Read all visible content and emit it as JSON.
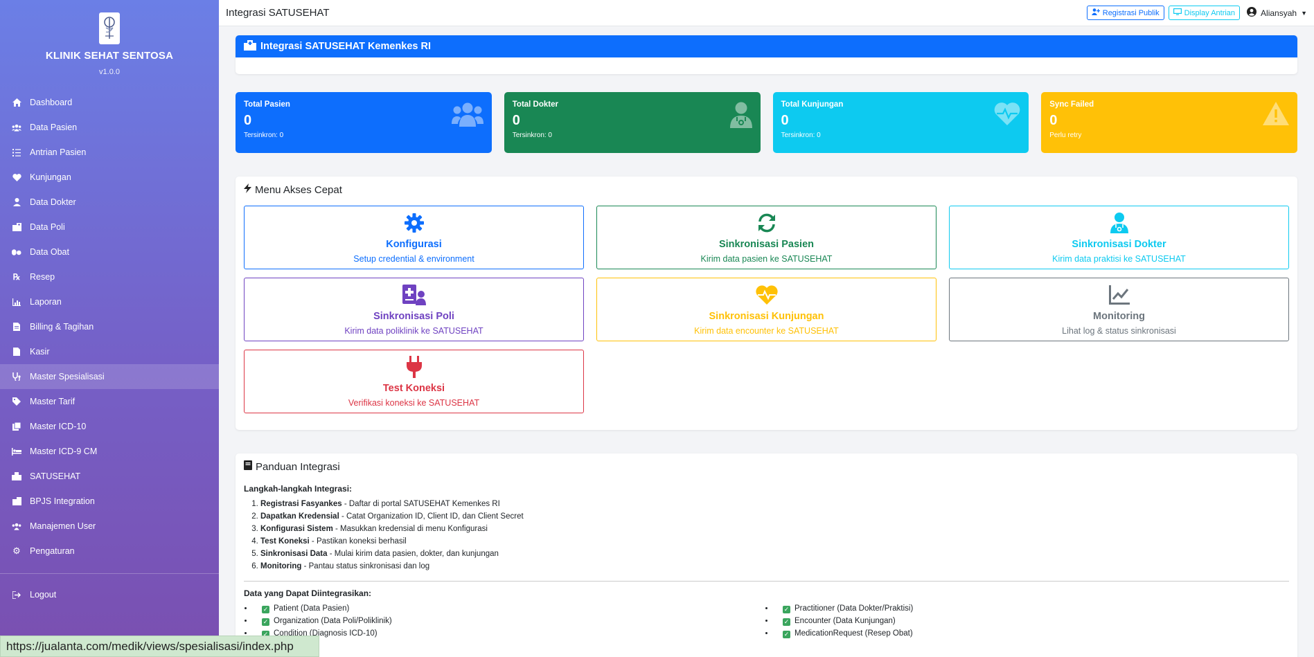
{
  "sidebar": {
    "brand_name": "KLINIK SEHAT SENTOSA",
    "version": "v1.0.0",
    "items": [
      {
        "label": "Dashboard",
        "icon": "home-icon"
      },
      {
        "label": "Data Pasien",
        "icon": "users-icon"
      },
      {
        "label": "Antrian Pasien",
        "icon": "list-ol-icon"
      },
      {
        "label": "Kunjungan",
        "icon": "heartbeat-icon"
      },
      {
        "label": "Data Dokter",
        "icon": "user-md-icon"
      },
      {
        "label": "Data Poli",
        "icon": "hospital-icon"
      },
      {
        "label": "Data Obat",
        "icon": "pills-icon"
      },
      {
        "label": "Resep",
        "icon": "prescription-icon"
      },
      {
        "label": "Laporan",
        "icon": "chart-line-icon"
      },
      {
        "label": "Billing & Tagihan",
        "icon": "invoice-icon"
      },
      {
        "label": "Kasir",
        "icon": "cash-register-icon"
      },
      {
        "label": "Master Spesialisasi",
        "icon": "stethoscope-icon"
      },
      {
        "label": "Master Tarif",
        "icon": "tags-icon"
      },
      {
        "label": "Master ICD-10",
        "icon": "book-medical-icon"
      },
      {
        "label": "Master ICD-9 CM",
        "icon": "procedures-icon"
      },
      {
        "label": "SATUSEHAT",
        "icon": "clinic-icon"
      },
      {
        "label": "BPJS Integration",
        "icon": "building-icon"
      },
      {
        "label": "Manajemen User",
        "icon": "users-cog-icon"
      },
      {
        "label": "Pengaturan",
        "icon": "cog-icon"
      }
    ],
    "logout": "Logout"
  },
  "topbar": {
    "title": "Integrasi SATUSEHAT",
    "btn_registrasi": "Registrasi Publik",
    "btn_display": "Display Antrian",
    "user": "Aliansyah"
  },
  "header": {
    "title": "Integrasi SATUSEHAT Kemenkes RI"
  },
  "stats": [
    {
      "label": "Total Pasien",
      "value": "0",
      "sub": "Tersinkron: 0",
      "color": "#0d6efd"
    },
    {
      "label": "Total Dokter",
      "value": "0",
      "sub": "Tersinkron: 0",
      "color": "#198754"
    },
    {
      "label": "Total Kunjungan",
      "value": "0",
      "sub": "Tersinkron: 0",
      "color": "#0dcaf0"
    },
    {
      "label": "Sync Failed",
      "value": "0",
      "sub": "Perlu retry",
      "color": "#ffc107"
    }
  ],
  "quick_access": {
    "title": "Menu Akses Cepat",
    "items": [
      {
        "title": "Konfigurasi",
        "desc": "Setup credential & environment",
        "color": "#0d6efd"
      },
      {
        "title": "Sinkronisasi Pasien",
        "desc": "Kirim data pasien ke SATUSEHAT",
        "color": "#198754"
      },
      {
        "title": "Sinkronisasi Dokter",
        "desc": "Kirim data praktisi ke SATUSEHAT",
        "color": "#0dcaf0"
      },
      {
        "title": "Sinkronisasi Poli",
        "desc": "Kirim data poliklinik ke SATUSEHAT",
        "color": "#6f42c1"
      },
      {
        "title": "Sinkronisasi Kunjungan",
        "desc": "Kirim data encounter ke SATUSEHAT",
        "color": "#ffc107"
      },
      {
        "title": "Monitoring",
        "desc": "Lihat log & status sinkronisasi",
        "color": "#6c757d"
      },
      {
        "title": "Test Koneksi",
        "desc": "Verifikasi koneksi ke SATUSEHAT",
        "color": "#dc3545"
      }
    ]
  },
  "guide": {
    "title": "Panduan Integrasi",
    "steps_heading": "Langkah-langkah Integrasi:",
    "steps": [
      {
        "bold": "Registrasi Fasyankes",
        "text": " - Daftar di portal SATUSEHAT Kemenkes RI"
      },
      {
        "bold": "Dapatkan Kredensial",
        "text": " - Catat Organization ID, Client ID, dan Client Secret"
      },
      {
        "bold": "Konfigurasi Sistem",
        "text": " - Masukkan kredensial di menu Konfigurasi"
      },
      {
        "bold": "Test Koneksi",
        "text": " - Pastikan koneksi berhasil"
      },
      {
        "bold": "Sinkronisasi Data",
        "text": " - Mulai kirim data pasien, dokter, dan kunjungan"
      },
      {
        "bold": "Monitoring",
        "text": " - Pantau status sinkronisasi dan log"
      }
    ],
    "data_heading": "Data yang Dapat Diintegrasikan:",
    "left_items": [
      "Patient (Data Pasien)",
      "Organization (Data Poli/Poliklinik)",
      "Condition (Diagnosis ICD-10)"
    ],
    "right_items": [
      "Practitioner (Data Dokter/Praktisi)",
      "Encounter (Data Kunjungan)",
      "MedicationRequest (Resep Obat)"
    ]
  },
  "statusbar": {
    "url": "https://jualanta.com/medik/views/spesialisasi/index.php"
  }
}
